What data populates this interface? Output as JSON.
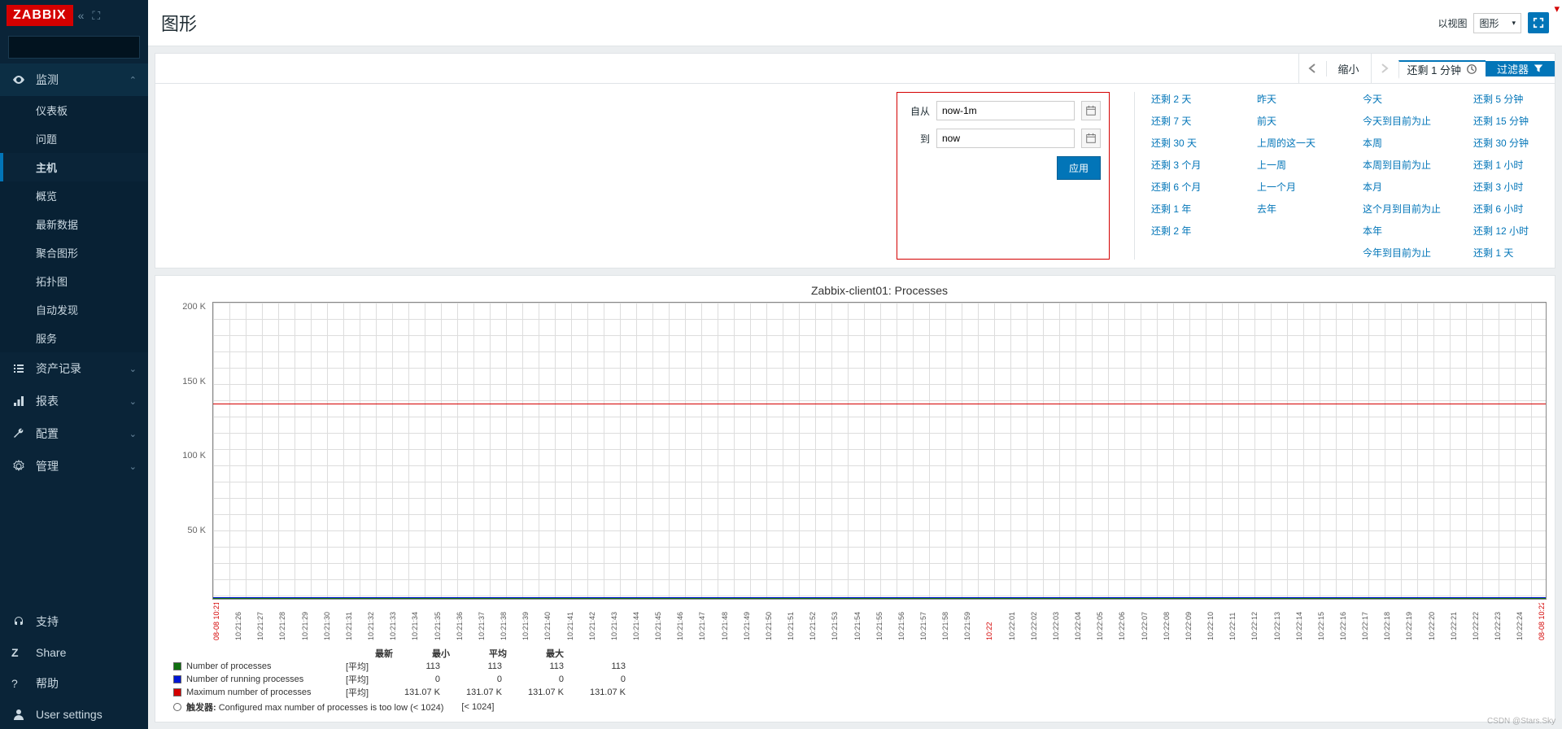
{
  "logo": "ZABBIX",
  "page_title": "图形",
  "header": {
    "view_label": "以视图",
    "view_select": "图形"
  },
  "sidebar": {
    "sections": [
      {
        "label": "监测",
        "expanded": true,
        "items": [
          "仪表板",
          "问题",
          "主机",
          "概览",
          "最新数据",
          "聚合图形",
          "拓扑图",
          "自动发现",
          "服务"
        ],
        "active_item": "主机"
      },
      {
        "label": "资产记录",
        "expanded": false
      },
      {
        "label": "报表",
        "expanded": false
      },
      {
        "label": "配置",
        "expanded": false
      },
      {
        "label": "管理",
        "expanded": false
      }
    ],
    "footer": [
      "支持",
      "Share",
      "帮助",
      "User settings"
    ]
  },
  "filter_bar": {
    "zoom_out": "缩小",
    "time_range_label": "还剩 1 分钟",
    "filter_label": "过滤器"
  },
  "time_form": {
    "from_label": "自从",
    "from_value": "now-1m",
    "to_label": "到",
    "to_value": "now",
    "apply": "应用"
  },
  "presets": {
    "col1": [
      "还剩 2 天",
      "还剩 7 天",
      "还剩 30 天",
      "还剩 3 个月",
      "还剩 6 个月",
      "还剩 1 年",
      "还剩 2 年"
    ],
    "col2": [
      "昨天",
      "前天",
      "上周的这一天",
      "上一周",
      "上一个月",
      "去年"
    ],
    "col3": [
      "今天",
      "今天到目前为止",
      "本周",
      "本周到目前为止",
      "本月",
      "这个月到目前为止",
      "本年",
      "今年到目前为止"
    ],
    "col4": [
      "还剩 5 分钟",
      "还剩 15 分钟",
      "还剩 30 分钟",
      "还剩 1 小时",
      "还剩 3 小时",
      "还剩 6 小时",
      "还剩 12 小时",
      "还剩 1 天"
    ]
  },
  "chart_data": {
    "type": "line",
    "title": "Zabbix-client01: Processes",
    "ylabel": "",
    "ylim": [
      0,
      200000
    ],
    "y_ticks": [
      "200 K",
      "150 K",
      "100 K",
      "50 K",
      ""
    ],
    "x_start": "08-08 10:21",
    "x_end": "08-08 10:22",
    "x_ticks": [
      "10:21:26",
      "10:21:27",
      "10:21:28",
      "10:21:29",
      "10:21:30",
      "10:21:31",
      "10:21:32",
      "10:21:33",
      "10:21:34",
      "10:21:35",
      "10:21:36",
      "10:21:37",
      "10:21:38",
      "10:21:39",
      "10:21:40",
      "10:21:41",
      "10:21:42",
      "10:21:43",
      "10:21:44",
      "10:21:45",
      "10:21:46",
      "10:21:47",
      "10:21:48",
      "10:21:49",
      "10:21:50",
      "10:21:51",
      "10:21:52",
      "10:21:53",
      "10:21:54",
      "10:21:55",
      "10:21:56",
      "10:21:57",
      "10:21:58",
      "10:21:59",
      "10:22",
      "10:22:01",
      "10:22:02",
      "10:22:03",
      "10:22:04",
      "10:22:05",
      "10:22:06",
      "10:22:07",
      "10:22:08",
      "10:22:09",
      "10:22:10",
      "10:22:11",
      "10:22:12",
      "10:22:13",
      "10:22:14",
      "10:22:15",
      "10:22:16",
      "10:22:17",
      "10:22:18",
      "10:22:19",
      "10:22:20",
      "10:22:21",
      "10:22:22",
      "10:22:23",
      "10:22:24"
    ],
    "series": [
      {
        "name": "Number of processes",
        "color": "#107010",
        "value": 113
      },
      {
        "name": "Number of running processes",
        "color": "#0016d4",
        "value": 0
      },
      {
        "name": "Maximum number of processes",
        "color": "#d40000",
        "value": 131070
      }
    ]
  },
  "legend": {
    "headers": [
      "最新",
      "最小",
      "平均",
      "最大"
    ],
    "fn": "[平均]",
    "rows": [
      {
        "name": "Number of processes",
        "color": "#107010",
        "vals": [
          "113",
          "113",
          "113",
          "113"
        ]
      },
      {
        "name": "Number of running processes",
        "color": "#0016d4",
        "vals": [
          "0",
          "0",
          "0",
          "0"
        ]
      },
      {
        "name": "Maximum number of processes",
        "color": "#d40000",
        "vals": [
          "131.07 K",
          "131.07 K",
          "131.07 K",
          "131.07 K"
        ]
      }
    ],
    "trigger_label": "触发器:",
    "trigger_text": "Configured max number of processes is too low (< 1024)",
    "trigger_bracket": "[< 1024]"
  },
  "watermark": "CSDN @Stars.Sky"
}
